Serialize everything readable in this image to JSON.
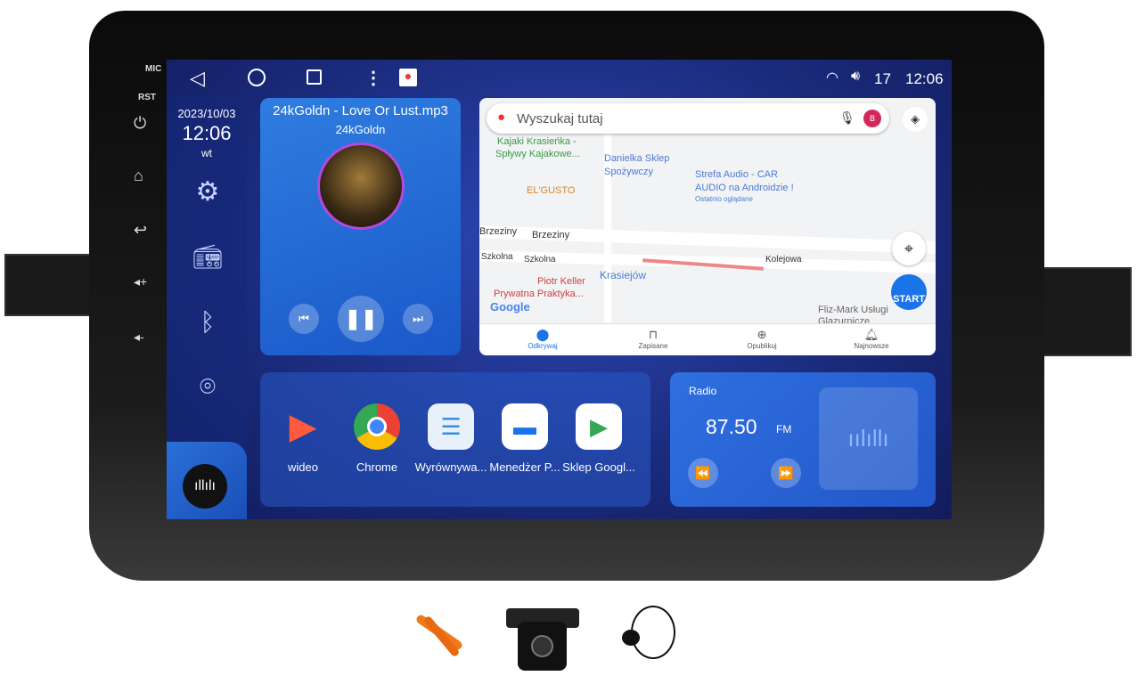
{
  "hardware": {
    "mic": "MIC",
    "rst": "RST"
  },
  "status_bar": {
    "volume": "17",
    "time": "12:06"
  },
  "sidebar": {
    "date": "2023/10/03",
    "time": "12:06",
    "weekday": "wt"
  },
  "music": {
    "title": "24kGoldn - Love Or Lust.mp3",
    "artist": "24kGoldn",
    "playing": true
  },
  "map": {
    "search_placeholder": "Wyszukaj tutaj",
    "avatar_letter": "B",
    "labels": [
      "Kajaki Krasieńka -",
      "Spływy Kajakowe...",
      "Danielka Sklep",
      "Spożywczy",
      "Strefa Audio - CAR",
      "AUDIO na Androidzie !",
      "Ostatnio oglądane",
      "EL'GUSTO",
      "Brzeziny",
      "Brzeziny",
      "Szkolna",
      "Szkolna",
      "Kolejowa",
      "Krasiejów",
      "Piotr Keller",
      "Prywatna Praktyka...",
      "Fliz-Mark Usługi",
      "Glazurnicze",
      "Google"
    ],
    "start_label": "START",
    "tabs": [
      {
        "label": "Odkrywaj",
        "active": true
      },
      {
        "label": "Zapisane"
      },
      {
        "label": "Opublikuj"
      },
      {
        "label": "Najnowsze"
      }
    ],
    "accent": "#1a73e8"
  },
  "apps": [
    {
      "label": "wideo"
    },
    {
      "label": "Chrome"
    },
    {
      "label": "Wyrównywa..."
    },
    {
      "label": "Menedżer P..."
    },
    {
      "label": "Sklep Googl..."
    }
  ],
  "radio": {
    "title": "Radio",
    "frequency": "87.50",
    "band": "FM"
  }
}
